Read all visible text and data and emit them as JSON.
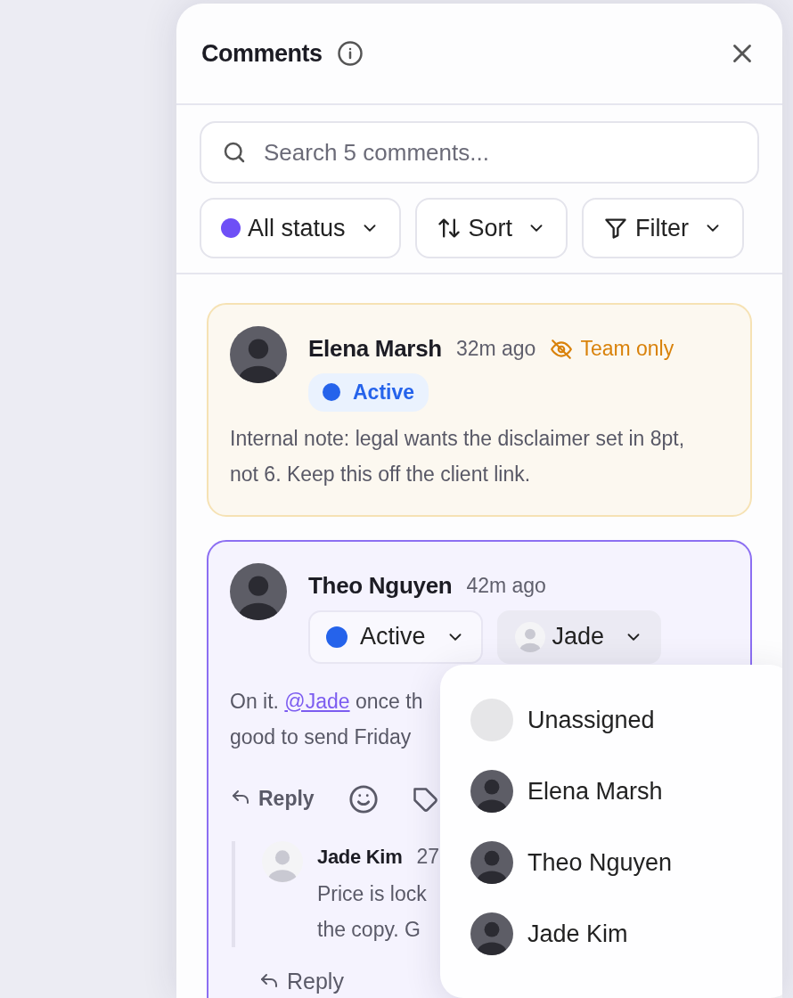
{
  "panel": {
    "title": "Comments",
    "search": {
      "placeholder": "Search 5 comments..."
    },
    "toolbar": [
      {
        "kind": "status",
        "label": "All status",
        "color": "#6e4ff6"
      },
      {
        "kind": "sort",
        "label": "Sort"
      },
      {
        "kind": "filter",
        "label": "Filter"
      }
    ]
  },
  "comments": [
    {
      "kind": "internal",
      "selected": false,
      "author": "Elena Marsh",
      "time": "32m ago",
      "visibility": "Team only",
      "status": {
        "label": "Active",
        "color": "#2563eb",
        "editable": false
      },
      "body": [
        {
          "text": "Internal note: legal wants the disclaimer set in 8pt, not 6. Keep this off the client link."
        }
      ]
    },
    {
      "kind": "normal",
      "selected": true,
      "author": "Theo Nguyen",
      "time": "42m ago",
      "status": {
        "label": "Active",
        "color": "#2563eb",
        "editable": true
      },
      "assignee": "Jade",
      "body": [
        {
          "text": "On it. "
        },
        {
          "text": "@Jade",
          "kind": "mention"
        },
        {
          "text": " once th"
        },
        {
          "kind": "break"
        },
        {
          "text": "good to send Friday"
        }
      ],
      "actions": [
        {
          "kind": "reply",
          "label": "Reply"
        },
        {
          "kind": "emoji"
        },
        {
          "kind": "tag"
        }
      ],
      "replies": [
        {
          "author": "Jade Kim",
          "time": "27",
          "body": [
            "Price is lock",
            "the copy. G"
          ]
        }
      ],
      "reply_link": "Reply"
    }
  ],
  "assignee_menu": [
    {
      "kind": "none",
      "label": "Unassigned"
    },
    {
      "kind": "person",
      "label": "Elena Marsh"
    },
    {
      "kind": "person",
      "label": "Theo Nguyen"
    },
    {
      "kind": "person",
      "label": "Jade Kim"
    }
  ]
}
